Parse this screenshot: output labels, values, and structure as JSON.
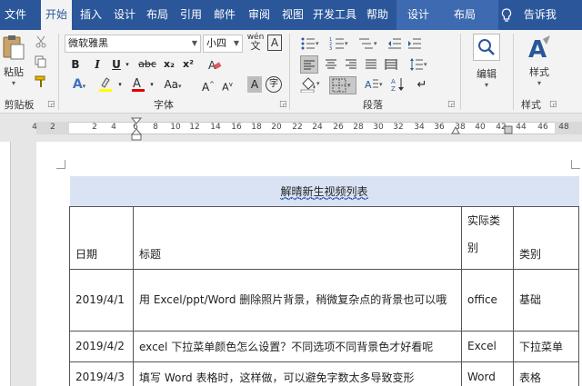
{
  "tabs": [
    {
      "label": "文件",
      "active": false
    },
    {
      "label": "开始",
      "active": true
    },
    {
      "label": "插入",
      "active": false
    },
    {
      "label": "设计",
      "active": false
    },
    {
      "label": "布局",
      "active": false
    },
    {
      "label": "引用",
      "active": false
    },
    {
      "label": "邮件",
      "active": false
    },
    {
      "label": "审阅",
      "active": false
    },
    {
      "label": "视图",
      "active": false
    },
    {
      "label": "开发工具",
      "active": false
    },
    {
      "label": "帮助",
      "active": false
    }
  ],
  "context_tabs": [
    {
      "label": "设计"
    },
    {
      "label": "布局"
    }
  ],
  "tell_me": {
    "label": "告诉我",
    "icon": "lightbulb-icon"
  },
  "ribbon": {
    "clipboard": {
      "paste_label": "粘贴",
      "group_label": "剪贴板"
    },
    "font": {
      "font_name": "微软雅黑",
      "font_size": "小四",
      "group_label": "字体",
      "phonetic_label": "wén",
      "bold": "B",
      "italic": "I",
      "underline": "U",
      "strike": "abc",
      "subscript": "x₂",
      "superscript": "x²",
      "grow": "A",
      "shrink": "A",
      "change_case": "Aa",
      "char_shade": "A",
      "enclose": "字"
    },
    "paragraph": {
      "group_label": "段落"
    },
    "editing": {
      "label": "编辑",
      "group_label": ""
    },
    "styles": {
      "label": "样式",
      "group_label": "样式"
    }
  },
  "ruler": {
    "ticks": [
      "4",
      "2",
      "2",
      "4",
      "6",
      "8",
      "10",
      "12",
      "14",
      "16",
      "18",
      "20",
      "22",
      "24",
      "26",
      "28",
      "30",
      "32",
      "34",
      "36",
      "38",
      "40",
      "42",
      "44",
      "46",
      "48"
    ]
  },
  "table": {
    "title": "解晴新生视频列表",
    "headers": [
      "日期",
      "标题",
      "实际类别",
      "类别"
    ],
    "rows": [
      [
        "2019/4/1",
        "用 Excel/ppt/Word 删除照片背景，稍微复杂点的背景也可以哦",
        "office",
        "基础"
      ],
      [
        "2019/4/2",
        "excel 下拉菜单颜色怎么设置？不同选项不同背景色才好看呢",
        "Excel",
        "下拉菜单"
      ],
      [
        "2019/4/3",
        "填写 Word 表格时，这样做，可以避免字数太多导致变形",
        "Word",
        "表格"
      ]
    ]
  },
  "colors": {
    "accent": "#2b579a",
    "ribbon_bg": "#f3f3f3",
    "title_fill": "#dae3f3"
  }
}
